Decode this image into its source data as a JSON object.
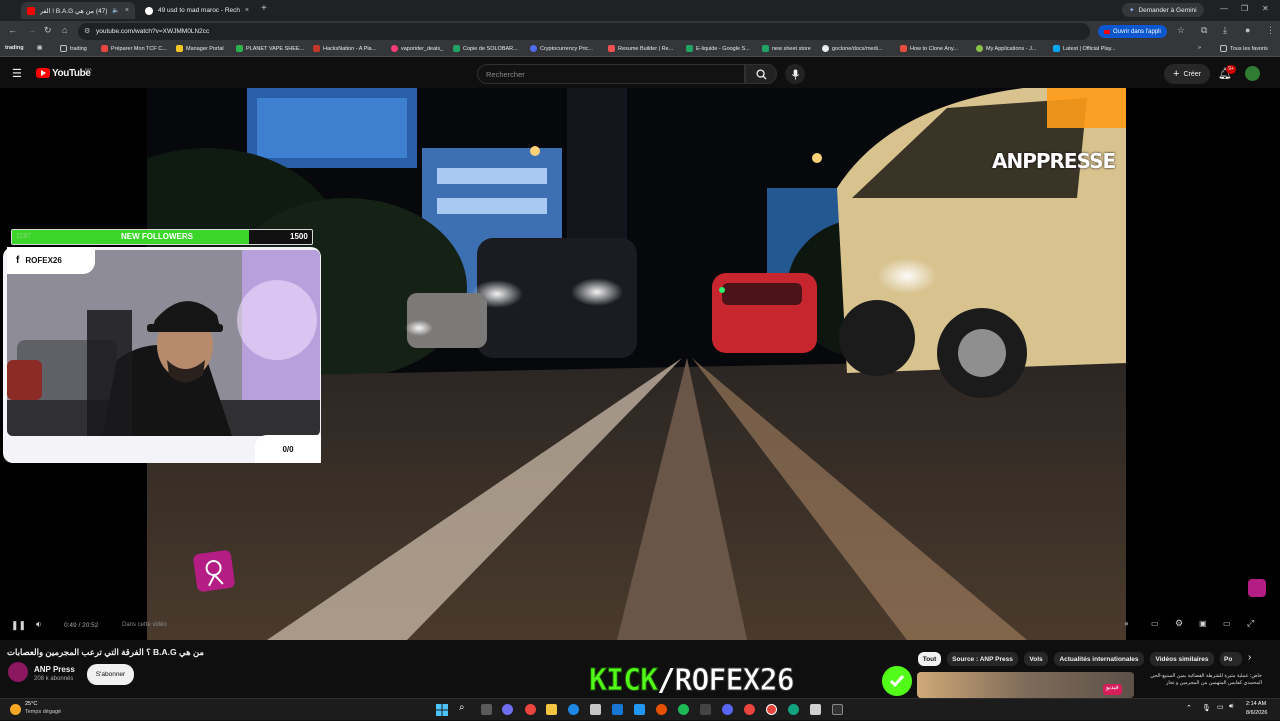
{
  "browser": {
    "tabs": [
      {
        "label": "(47) من هي B.A.G ! الفرقة",
        "active": true
      },
      {
        "label": "49 usd to mad maroc - Recher",
        "active": false
      }
    ],
    "new_tab": "+",
    "gemini_label": "Demander à Gemini",
    "url": "youtube.com/watch?v=XWJMM0LN2cc",
    "open_app_label": "Ouvrir dans l'appli",
    "all_bookmarks_label": "Tous les favoris",
    "bookmarks": [
      "trading",
      "Préparer Mon TCF C...",
      "Manager Portal",
      "PLANET VAPE SHEE...",
      "HacksNation - A Pla...",
      "vaporider_deals_",
      "Copie de SOLOBAR...",
      "Cryptocurrency Pric...",
      "Resume Builder | Re...",
      "E-liquide - Google S...",
      "new sheet store",
      "goclone/docs/medi...",
      "How to Clone Any...",
      "My Applications - J...",
      "Latest | Official Play..."
    ],
    "bookmark_folder_first": "trading"
  },
  "youtube": {
    "logo_text": "YouTube",
    "logo_region": "MA",
    "search_placeholder": "Rechercher",
    "create_label": "Créer",
    "notifications_count": "9+"
  },
  "video": {
    "watermark": "ANPPRESSE",
    "time_current": "0:49",
    "time_total": "20:52",
    "time_separator": " / ",
    "chapter_label": "Dans cette vidéo",
    "progress_fraction": 0.039
  },
  "overlay": {
    "followers_current": "1187",
    "followers_label": "NEW FOLLOWERS",
    "followers_goal": "1500",
    "followers_fraction": 0.79,
    "facebook_handle": "ROFEX26",
    "counter": "0/0",
    "kick_brand": "KICK",
    "kick_slash": "/",
    "kick_handle": "ROFEX26"
  },
  "meta": {
    "title": "من هي B.A.G ؟ الفرقة التي ترعب المجرمين والعصابات",
    "channel_name": "ANP Press",
    "subscribers": "208 k abonnés",
    "subscribe_label": "S'abonner"
  },
  "chips": [
    {
      "label": "Tout",
      "active": true
    },
    {
      "label": "Source : ANP Press",
      "active": false
    },
    {
      "label": "Vols",
      "active": false
    },
    {
      "label": "Actualités internationales",
      "active": false
    },
    {
      "label": "Vidéos similaires",
      "active": false
    },
    {
      "label": "Po",
      "active": false
    }
  ],
  "recommended": {
    "snippet": "خاص: عملية مثيرة للشرطة القضائية بمين السنيع-الحي المحمدي كفايس المتهمين من المجرمين و تجار",
    "thumb_badge": "فيديو"
  },
  "taskbar": {
    "temperature": "25°C",
    "weather": "Temps dégagé",
    "time": "2:14 AM",
    "date": "8/6/2026"
  },
  "colors": {
    "kick_green": "#53fc18",
    "youtube_red": "#ff0000",
    "followers_green": "#3cd62a",
    "open_app_blue": "#0b57d0"
  }
}
